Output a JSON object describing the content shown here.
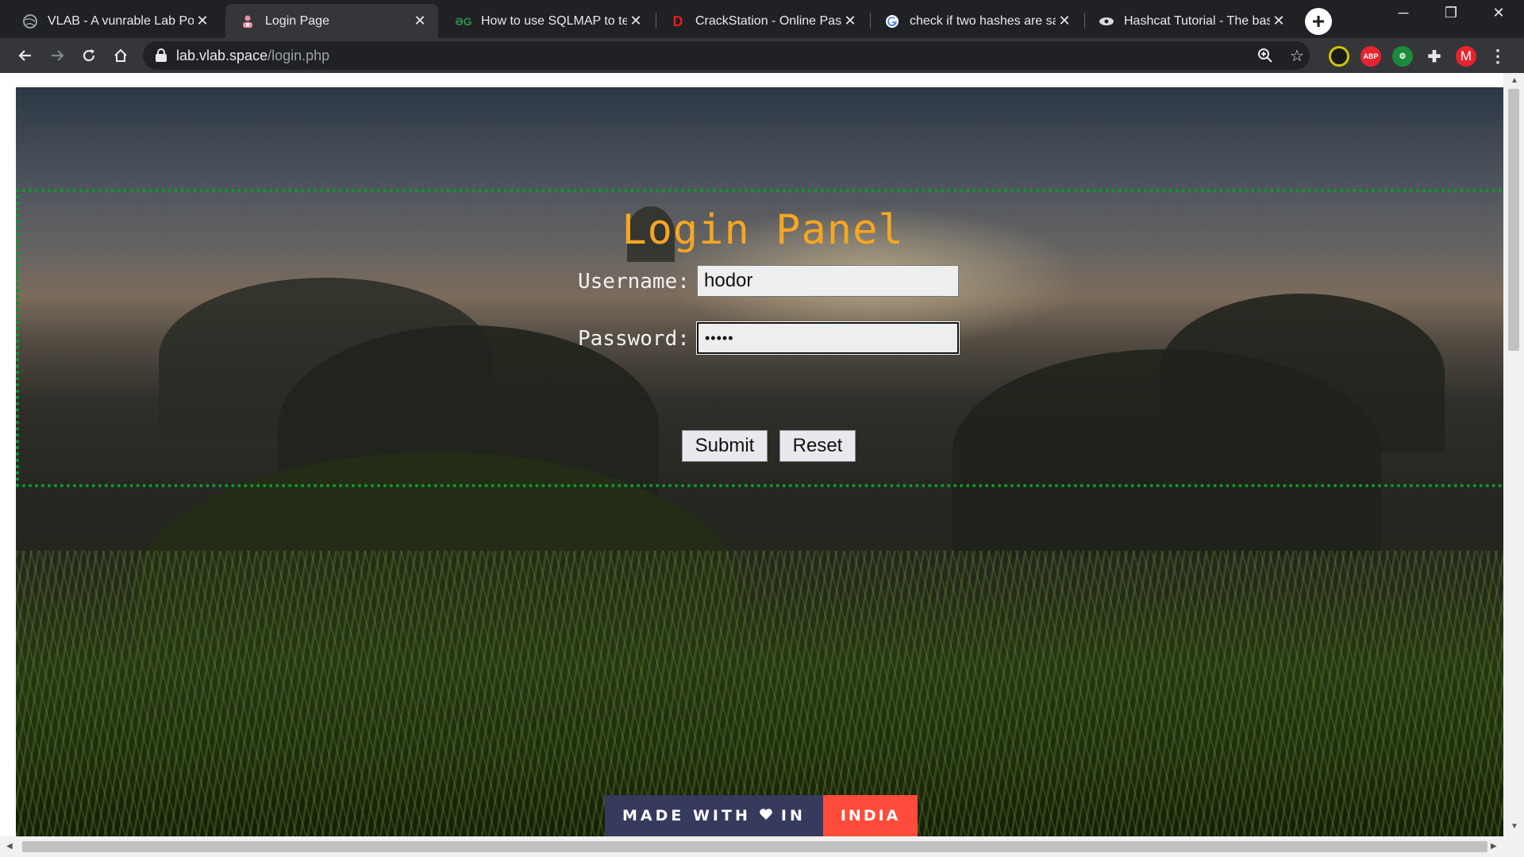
{
  "browser": {
    "tabs": [
      {
        "title": "VLAB - A vunrable Lab Portal",
        "favicon": "globe-icon",
        "active": false
      },
      {
        "title": "Login Page",
        "favicon": "user-icon",
        "active": true
      },
      {
        "title": "How to use SQLMAP to test",
        "favicon": "gfg-icon",
        "active": false
      },
      {
        "title": "CrackStation - Online Passw",
        "favicon": "crackstation-icon",
        "active": false
      },
      {
        "title": "check if two hashes are same",
        "favicon": "google-icon",
        "active": false
      },
      {
        "title": "Hashcat Tutorial - The basics",
        "favicon": "eye-icon",
        "active": false
      }
    ],
    "url_host": "lab.vlab.space",
    "url_path": "/login.php",
    "profile_initial": "M",
    "abp_label": "ABP"
  },
  "page": {
    "title": "Login Panel",
    "username_label": "Username:",
    "username_value": "hodor",
    "password_label": "Password:",
    "password_value": "•••••",
    "submit_label": "Submit",
    "reset_label": "Reset",
    "made_with_prefix": "MADE WITH",
    "made_with_suffix": "IN",
    "made_country": "INDIA"
  },
  "colors": {
    "title": "#f5a623",
    "panel_border": "#0b9a2e",
    "badge_dark": "#363a5c",
    "badge_red": "#ff4b3a"
  }
}
